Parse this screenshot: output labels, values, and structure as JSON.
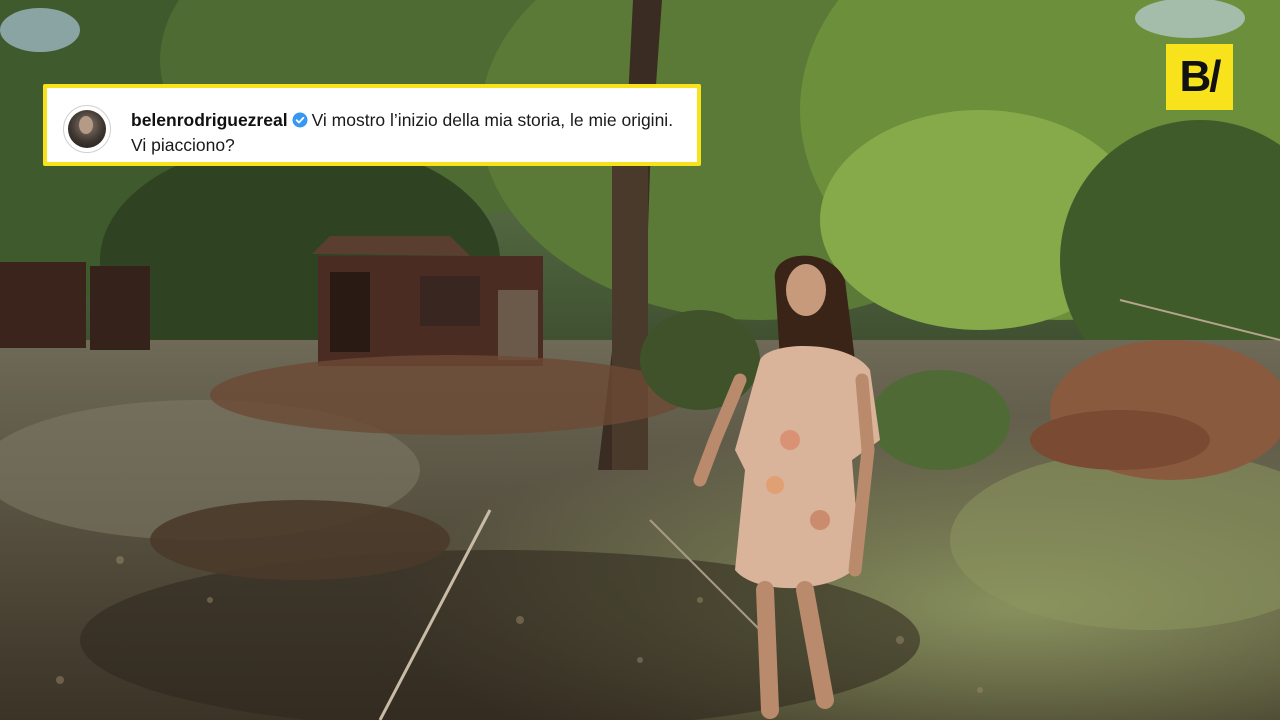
{
  "post": {
    "username": "belenrodriguezreal",
    "caption": "Vi mostro l’inizio della mia storia, le mie origini. Vi piacciono?",
    "verified": true,
    "verified_color": "#3897f0"
  },
  "brand": {
    "logo_text": "B/",
    "accent_color": "#f7e21c"
  }
}
